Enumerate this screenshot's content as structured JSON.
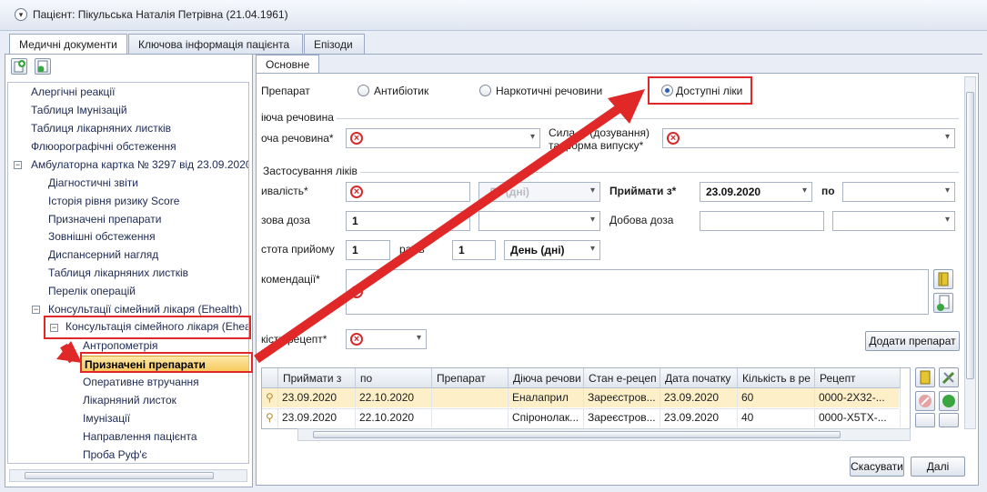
{
  "header": {
    "title": "Пацієнт: Пікульська Наталія Петрівна (21.04.1961)"
  },
  "tabs": [
    "Медичні документи",
    "Ключова інформація пацієнта",
    "Епізоди"
  ],
  "tree": {
    "items": [
      "Алергічні реакції",
      "Таблиця Імунізацій",
      "Таблиця лікарняних листків",
      "Флюорографічні обстеження",
      "Амбулаторна картка № 3297 від 23.09.2020",
      "Діагностичні звіти",
      "Історія рівня ризику Score",
      "Призначені препарати",
      "Зовнішні обстеження",
      "Диспансерний нагляд",
      "Таблиця лікарняних листків",
      "Перелік операцій",
      "Консультації сімейний лікаря (Ehealth)",
      "Консультація сімейного лікаря (Ehea",
      "Антропометрія",
      "Призначені препарати",
      "Оперативне втручання",
      "Лікарняний листок",
      "Імунізації",
      "Направлення пацієнта",
      "Проба Руф'є"
    ]
  },
  "form": {
    "tab": "Основне",
    "drug_label": "Препарат",
    "radio": {
      "antibiotic": "Антибіотик",
      "narcotic": "Наркотичні речовини",
      "available": "Доступні ліки"
    },
    "group1": "іюча речовина",
    "substance_label": "оча речовина*",
    "strength_label_1": "Сила ді (дозування)",
    "strength_label_2": "та форма випуску*",
    "group2": "Застосування ліків",
    "duration_label": "ивалість*",
    "duration_unit": "Де (дні)",
    "take_from_label": "Приймати з*",
    "take_from_value": "23.09.2020",
    "to_label": "по",
    "single_dose_label": "зова доза",
    "single_dose_value": "1",
    "daily_dose_label": "Добова доза",
    "freq_label": "стота прийому",
    "freq_value": "1",
    "times_label": "разів",
    "per_value": "1",
    "period_value": "День (дні)",
    "recommend_label": "комендації*",
    "recipe_label": "кість рецепт*",
    "add_button": "Додати препарат"
  },
  "grid": {
    "headers": [
      "Приймати з",
      "по",
      "Препарат",
      "Діюча речови",
      "Стан е-рецеп",
      "Дата початку",
      "Кількість в ре",
      "Рецепт"
    ],
    "rows": [
      [
        "23.09.2020",
        "22.10.2020",
        "",
        "Еналаприл",
        "Зареєстров...",
        "23.09.2020",
        "60",
        "0000-2X32-..."
      ],
      [
        "23.09.2020",
        "22.10.2020",
        "",
        "Спіронолак...",
        "Зареєстров...",
        "23.09.2020",
        "40",
        "0000-X5TX-..."
      ]
    ]
  },
  "footer": {
    "cancel": "Скасувати",
    "next": "Далі"
  },
  "colors": {
    "annotation_red": "#e02828",
    "selection": "#f7c85b",
    "accent": "#2c62b9"
  }
}
